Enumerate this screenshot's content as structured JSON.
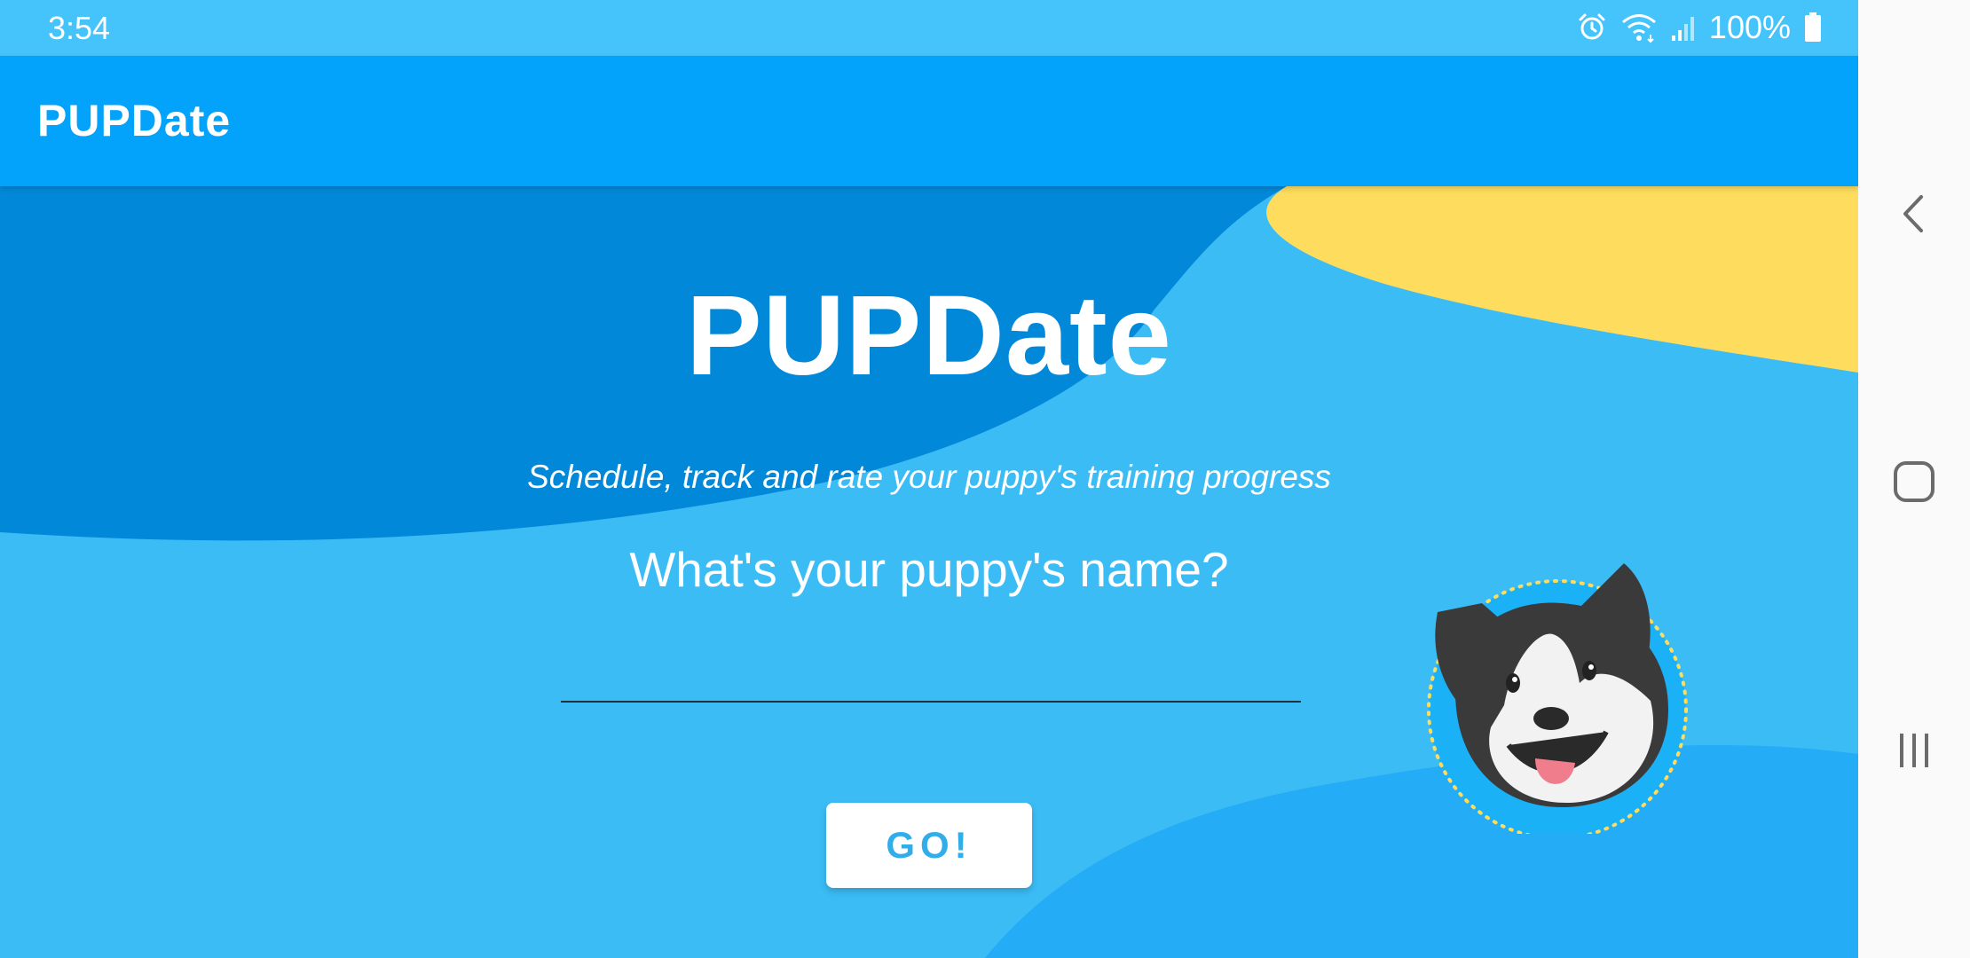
{
  "status_bar": {
    "time": "3:54",
    "battery": "100%",
    "icons": [
      "alarm-icon",
      "wifi-icon",
      "signal-icon",
      "battery-icon"
    ]
  },
  "toolbar": {
    "title": "PUPDate"
  },
  "main": {
    "title": "PUPDate",
    "tagline": "Schedule, track and rate your puppy's training progress",
    "question": "What's your puppy's name?",
    "name_input": {
      "value": "",
      "placeholder": ""
    },
    "go_button": "GO!"
  },
  "nav_bar": {
    "icons": [
      "back-icon",
      "home-icon",
      "recents-icon"
    ]
  },
  "colors": {
    "status_bar": "#45c3fb",
    "toolbar": "#03a2fb",
    "background": "#3bbcf5",
    "dark_wave": "#0288d8",
    "yellow_wave": "#fedc5e",
    "button_text": "#31aee9"
  }
}
